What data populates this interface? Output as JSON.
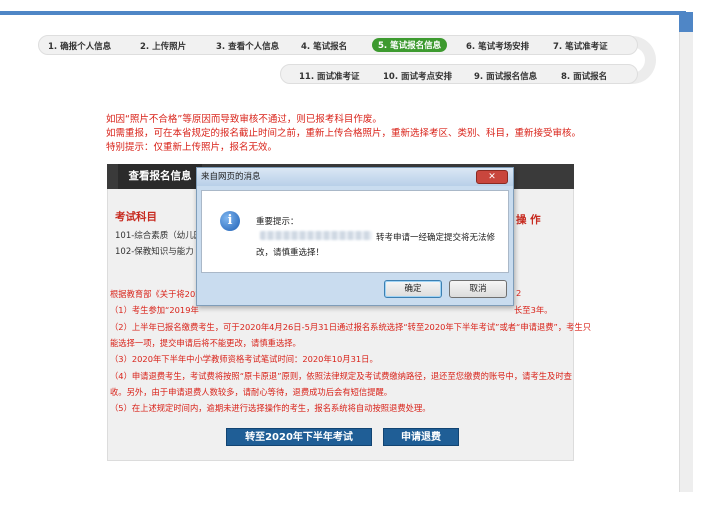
{
  "nav": {
    "steps_row1": [
      "1. 确报个人信息",
      "2. 上传照片",
      "3. 查看个人信息",
      "4. 笔试报名",
      "5. 笔试报名信息",
      "6. 笔试考场安排",
      "7. 笔试准考证"
    ],
    "steps_row2": [
      "11. 面试准考证",
      "10. 面试考点安排",
      "9. 面试报名信息",
      "8. 面试报名"
    ],
    "active_step": "5. 笔试报名信息"
  },
  "warnings": [
    "如因“照片不合格”等原因而导致审核不通过，则已报考科目作废。",
    "如需重报，可在本省规定的报名截止时间之前，重新上传合格照片，重新选择考区、类别、科目，重新接受审核。",
    "特别提示：仅重新上传照片，报名无效。"
  ],
  "panel": {
    "tab_label": "查看报名信息",
    "subjects_heading": "考试科目",
    "operations_heading": "操 作",
    "subjects": [
      "101-综合素质（幼儿园",
      "102-保教知识与能力"
    ],
    "notes": [
      "根据教育部《关于将2020",
      "（1）考生参加“2019年",
      "（2）上半年已报名缴费考生，可于2020年4月26日-5月31日通过报名系统选择“转至2020年下半年考试”或者“申请退费”，考生只",
      "能选择一项，提交申请后将不能更改，请慎重选择。",
      "（3）2020年下半年中小学教师资格考试笔试时间：2020年10月31日。",
      "（4）申请退费考生，考试费将按照“原卡原退”原则，依照法律规定及考试费缴纳路径，退还至您缴费的账号中，请考生及时查",
      "收。另外，由于申请退费人数较多，请耐心等待，退费成功后会有短信提醒。",
      "（5）在上述规定时间内，逾期未进行选择操作的考生，报名系统将自动按照退费处理。"
    ],
    "note_right_fragment_1": "2",
    "note_right_fragment_2": "长至3年。",
    "transfer_button": "转至2020年下半年考试",
    "refund_button": "申请退费"
  },
  "dialog": {
    "title": "来自网页的消息",
    "close_label": "✕",
    "heading": "重要提示：",
    "message_line1": "转考申请一经确定提交将无法修",
    "message_line2": "改，请慎重选择！",
    "ok_label": "确定",
    "cancel_label": "取消"
  }
}
